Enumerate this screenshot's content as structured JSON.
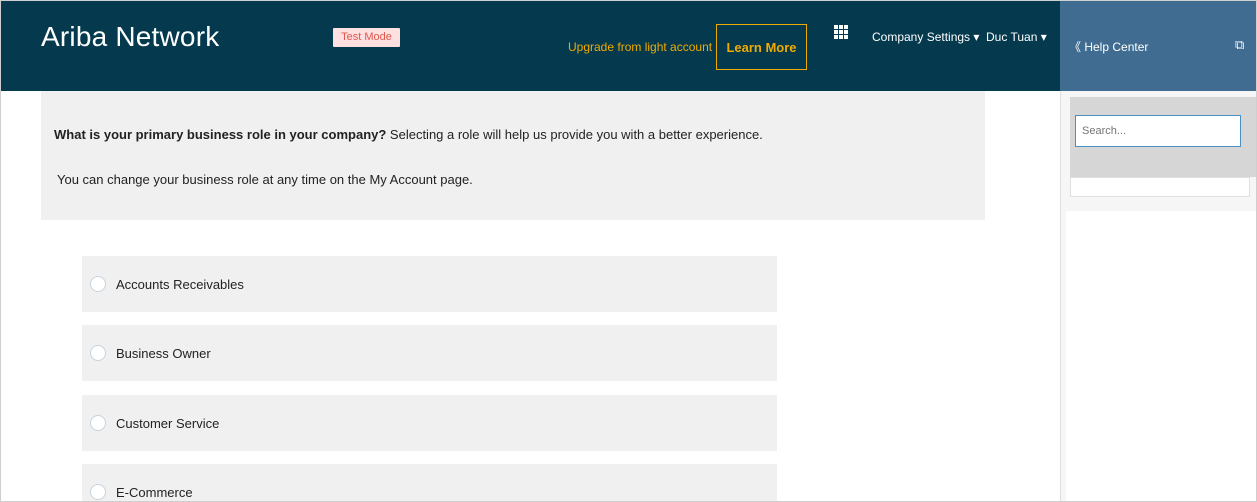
{
  "header": {
    "brand": "Ariba Network",
    "test_mode": "Test Mode",
    "upgrade_text": "Upgrade from light account",
    "learn_more": "Learn More",
    "apps_icon": "apps-grid-icon",
    "company_settings": "Company Settings ▾",
    "user_menu": "Duc Tuan ▾"
  },
  "help": {
    "title": "《 Help Center",
    "external_icon": "⧉",
    "search_placeholder": "Search..."
  },
  "intro": {
    "question_bold": "What is your primary business role in your company?",
    "question_rest": " Selecting a role will help us provide you with a better experience.",
    "note": "You can change your business role at any time on the My Account page."
  },
  "roles": [
    {
      "label": "Accounts Receivables"
    },
    {
      "label": "Business Owner"
    },
    {
      "label": "Customer Service"
    },
    {
      "label": "E-Commerce"
    }
  ],
  "colors": {
    "header_bg": "#04394e",
    "help_header_bg": "#3f6c90",
    "accent_orange": "#f0ab00"
  }
}
